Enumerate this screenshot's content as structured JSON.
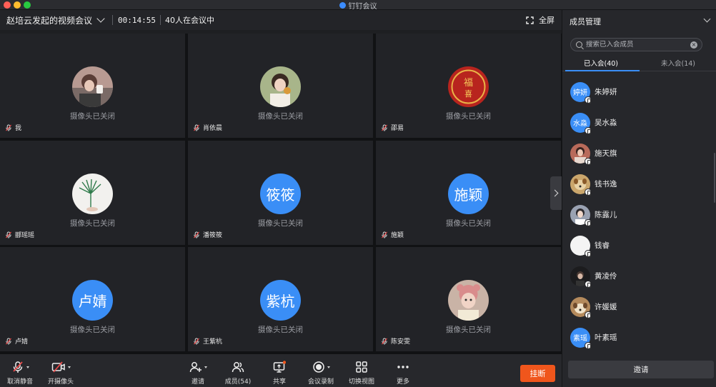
{
  "app": {
    "title": "钉钉会议"
  },
  "meeting": {
    "title": "赵培云发起的视频会议",
    "elapsed": "00:14:55",
    "participants_text": "40人在会议中",
    "fullscreen_label": "全屏"
  },
  "grid": {
    "camera_off_text": "摄像头已关闭",
    "tiles": [
      {
        "name": "我",
        "avatar_text": "",
        "avatar_type": "photo-person-cup"
      },
      {
        "name": "肖依晨",
        "avatar_text": "",
        "avatar_type": "photo-person-drink"
      },
      {
        "name": "邵易",
        "avatar_text": "",
        "avatar_type": "photo-red-seal"
      },
      {
        "name": "郦瑶瑶",
        "avatar_text": "",
        "avatar_type": "photo-palm-leaf"
      },
      {
        "name": "潘筱筱",
        "avatar_text": "筱筱",
        "avatar_type": "text"
      },
      {
        "name": "施颖",
        "avatar_text": "施颖",
        "avatar_type": "text"
      },
      {
        "name": "卢婧",
        "avatar_text": "卢婧",
        "avatar_type": "text"
      },
      {
        "name": "王紫杭",
        "avatar_text": "紫杭",
        "avatar_type": "text"
      },
      {
        "name": "陈安雯",
        "avatar_text": "",
        "avatar_type": "photo-child"
      }
    ]
  },
  "toolbar": {
    "unmute": "取消静音",
    "start_camera": "开摄像头",
    "invite": "邀请",
    "members": "成员(54)",
    "share": "共享",
    "record": "会议录制",
    "switch_view": "切换视图",
    "more": "更多",
    "hangup": "挂断"
  },
  "panel": {
    "title": "成员管理",
    "search_placeholder": "搜索已入会成员",
    "tab_joined": "已入会(40)",
    "tab_not_joined": "未入会(14)",
    "invite": "邀请",
    "members": [
      {
        "name": "朱婷妍",
        "avatar_text": "婷妍",
        "avatar_type": "text"
      },
      {
        "name": "吴水淼",
        "avatar_text": "水淼",
        "avatar_type": "text"
      },
      {
        "name": "施天旗",
        "avatar_text": "",
        "avatar_type": "photo-woman"
      },
      {
        "name": "钱书逸",
        "avatar_text": "",
        "avatar_type": "photo-dog"
      },
      {
        "name": "陈露儿",
        "avatar_text": "",
        "avatar_type": "photo-portrait"
      },
      {
        "name": "钱睿",
        "avatar_text": "",
        "avatar_type": "photo-white"
      },
      {
        "name": "黄凌伶",
        "avatar_text": "",
        "avatar_type": "photo-dark"
      },
      {
        "name": "许媛媛",
        "avatar_text": "",
        "avatar_type": "photo-dog2"
      },
      {
        "name": "叶素瑶",
        "avatar_text": "素瑶",
        "avatar_type": "text"
      }
    ]
  },
  "colors": {
    "accent": "#3a8ef6",
    "hangup": "#f0561c",
    "background": "#1e1f22",
    "tile": "#222327"
  }
}
